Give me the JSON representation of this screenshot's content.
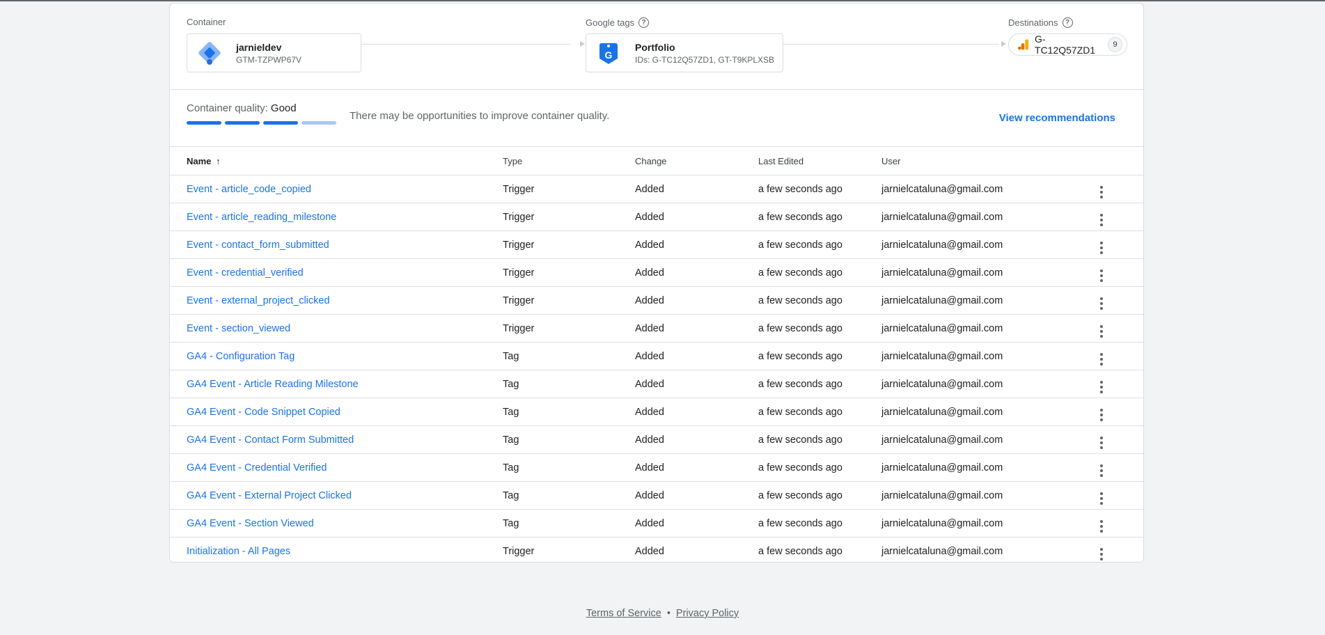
{
  "flow": {
    "container_label": "Container",
    "container": {
      "name": "jarnieldev",
      "id": "GTM-TZPWP67V"
    },
    "google_tags_label": "Google tags",
    "google_tag": {
      "name": "Portfolio",
      "ids": "IDs: G-TC12Q57ZD1, GT-T9KPLXSB"
    },
    "destinations_label": "Destinations",
    "destination": {
      "id": "G-TC12Q57ZD1",
      "count": "9"
    },
    "help_glyph": "?"
  },
  "quality": {
    "label": "Container quality:",
    "value": "Good",
    "message": "There may be opportunities to improve container quality.",
    "link": "View recommendations",
    "score": 3,
    "max": 4
  },
  "colors": {
    "accent": "#1a73e8",
    "bar_light": "#a8c7fa"
  },
  "table": {
    "headers": {
      "name": "Name",
      "type": "Type",
      "change": "Change",
      "last_edited": "Last Edited",
      "user": "User"
    },
    "sort_glyph": "↑",
    "rows": [
      {
        "name": "Event - article_code_copied",
        "type": "Trigger",
        "change": "Added",
        "edited": "a few seconds ago",
        "user": "jarnielcataluna@gmail.com"
      },
      {
        "name": "Event - article_reading_milestone",
        "type": "Trigger",
        "change": "Added",
        "edited": "a few seconds ago",
        "user": "jarnielcataluna@gmail.com"
      },
      {
        "name": "Event - contact_form_submitted",
        "type": "Trigger",
        "change": "Added",
        "edited": "a few seconds ago",
        "user": "jarnielcataluna@gmail.com"
      },
      {
        "name": "Event - credential_verified",
        "type": "Trigger",
        "change": "Added",
        "edited": "a few seconds ago",
        "user": "jarnielcataluna@gmail.com"
      },
      {
        "name": "Event - external_project_clicked",
        "type": "Trigger",
        "change": "Added",
        "edited": "a few seconds ago",
        "user": "jarnielcataluna@gmail.com"
      },
      {
        "name": "Event - section_viewed",
        "type": "Trigger",
        "change": "Added",
        "edited": "a few seconds ago",
        "user": "jarnielcataluna@gmail.com"
      },
      {
        "name": "GA4 - Configuration Tag",
        "type": "Tag",
        "change": "Added",
        "edited": "a few seconds ago",
        "user": "jarnielcataluna@gmail.com"
      },
      {
        "name": "GA4 Event - Article Reading Milestone",
        "type": "Tag",
        "change": "Added",
        "edited": "a few seconds ago",
        "user": "jarnielcataluna@gmail.com"
      },
      {
        "name": "GA4 Event - Code Snippet Copied",
        "type": "Tag",
        "change": "Added",
        "edited": "a few seconds ago",
        "user": "jarnielcataluna@gmail.com"
      },
      {
        "name": "GA4 Event - Contact Form Submitted",
        "type": "Tag",
        "change": "Added",
        "edited": "a few seconds ago",
        "user": "jarnielcataluna@gmail.com"
      },
      {
        "name": "GA4 Event - Credential Verified",
        "type": "Tag",
        "change": "Added",
        "edited": "a few seconds ago",
        "user": "jarnielcataluna@gmail.com"
      },
      {
        "name": "GA4 Event - External Project Clicked",
        "type": "Tag",
        "change": "Added",
        "edited": "a few seconds ago",
        "user": "jarnielcataluna@gmail.com"
      },
      {
        "name": "GA4 Event - Section Viewed",
        "type": "Tag",
        "change": "Added",
        "edited": "a few seconds ago",
        "user": "jarnielcataluna@gmail.com"
      },
      {
        "name": "Initialization - All Pages",
        "type": "Trigger",
        "change": "Added",
        "edited": "a few seconds ago",
        "user": "jarnielcataluna@gmail.com"
      }
    ]
  },
  "footer": {
    "terms": "Terms of Service",
    "separator": "•",
    "privacy": "Privacy Policy"
  }
}
